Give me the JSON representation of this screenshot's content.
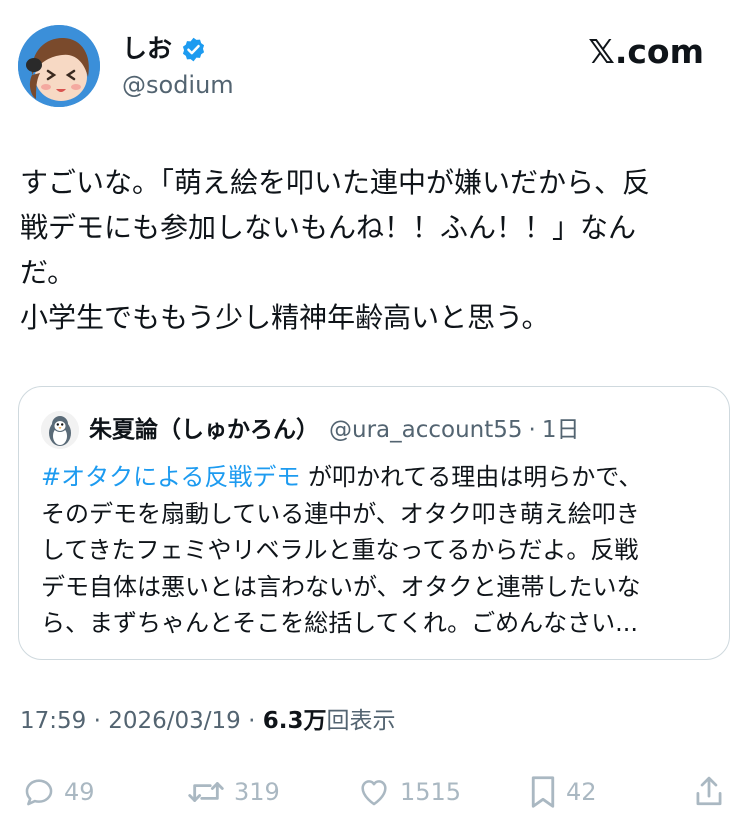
{
  "author": {
    "display_name": "しお",
    "handle": "@sodium",
    "verified": true,
    "avatar": "avatar-cartoon-girl"
  },
  "brand": "𝕏.com",
  "tweet": {
    "lines": [
      "すごいな。「萌え絵を叩いた連中が嫌いだから、反",
      "戦デモにも参加しないもんね！！ふん！！」なん",
      "だ。",
      "小学生でももう少し精神年齢高いと思う。"
    ]
  },
  "quote": {
    "avatar": "penguin-avatar",
    "name": "朱夏論（しゅかろん）",
    "handle": "@ura_account55",
    "separator": "·",
    "time": "1日",
    "hashtag": "#オタクによる反戦デモ",
    "first_line_rest": " が叩かれてる理由は明らかで、",
    "lines": [
      "そのデモを扇動している連中が、オタク叩き萌え絵叩き",
      "してきたフェミやリベラルと重なってるからだよ。反戦",
      "デモ自体は悪いとは言わないが、オタクと連帯したいな",
      "ら、まずちゃんとそこを総括してくれ。ごめんなさい..."
    ]
  },
  "meta": {
    "time": "17:59",
    "separator": " · ",
    "date": "2026/03/19",
    "separator2": " · ",
    "views_count": "6.3万",
    "views_label": "回表示"
  },
  "actions": {
    "reply": {
      "icon": "reply-icon",
      "count": "49"
    },
    "retweet": {
      "icon": "retweet-icon",
      "count": "319"
    },
    "like": {
      "icon": "heart-icon",
      "count": "1515"
    },
    "bookmark": {
      "icon": "bookmark-icon",
      "count": "42"
    },
    "share": {
      "icon": "share-icon"
    }
  },
  "colors": {
    "link": "#1d9bf0",
    "text": "#0f1419",
    "secondary": "#536471",
    "action_gray": "#aab8c2",
    "verified": "#1d9bf0",
    "avatar_bg": "#3b8fd9"
  }
}
